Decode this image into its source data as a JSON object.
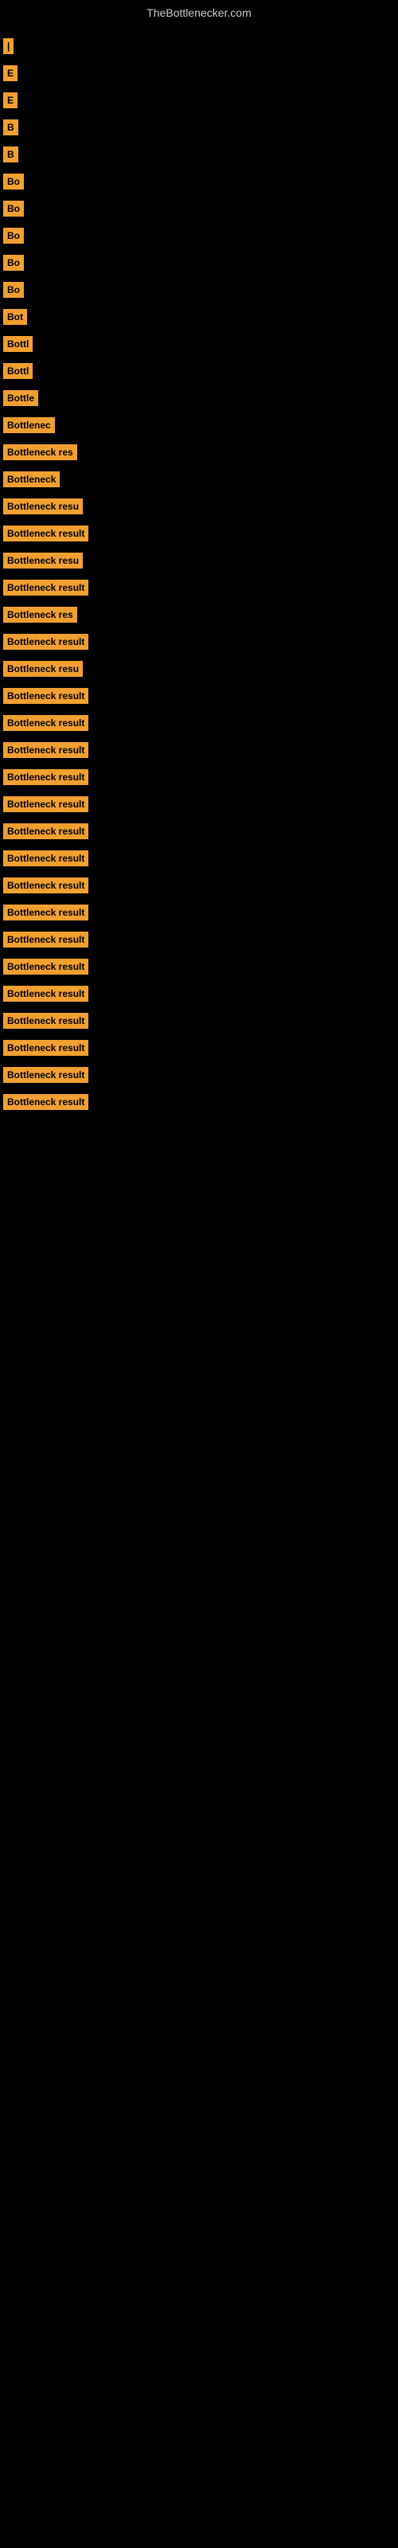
{
  "site": {
    "title": "TheBottlenecker.com"
  },
  "items": [
    {
      "id": 1,
      "label": "|"
    },
    {
      "id": 2,
      "label": "E"
    },
    {
      "id": 3,
      "label": "E"
    },
    {
      "id": 4,
      "label": "B"
    },
    {
      "id": 5,
      "label": "B"
    },
    {
      "id": 6,
      "label": "Bo"
    },
    {
      "id": 7,
      "label": "Bo"
    },
    {
      "id": 8,
      "label": "Bo"
    },
    {
      "id": 9,
      "label": "Bo"
    },
    {
      "id": 10,
      "label": "Bo"
    },
    {
      "id": 11,
      "label": "Bot"
    },
    {
      "id": 12,
      "label": "Bottl"
    },
    {
      "id": 13,
      "label": "Bottl"
    },
    {
      "id": 14,
      "label": "Bottle"
    },
    {
      "id": 15,
      "label": "Bottlenec"
    },
    {
      "id": 16,
      "label": "Bottleneck res"
    },
    {
      "id": 17,
      "label": "Bottleneck"
    },
    {
      "id": 18,
      "label": "Bottleneck resu"
    },
    {
      "id": 19,
      "label": "Bottleneck result"
    },
    {
      "id": 20,
      "label": "Bottleneck resu"
    },
    {
      "id": 21,
      "label": "Bottleneck result"
    },
    {
      "id": 22,
      "label": "Bottleneck res"
    },
    {
      "id": 23,
      "label": "Bottleneck result"
    },
    {
      "id": 24,
      "label": "Bottleneck resu"
    },
    {
      "id": 25,
      "label": "Bottleneck result"
    },
    {
      "id": 26,
      "label": "Bottleneck result"
    },
    {
      "id": 27,
      "label": "Bottleneck result"
    },
    {
      "id": 28,
      "label": "Bottleneck result"
    },
    {
      "id": 29,
      "label": "Bottleneck result"
    },
    {
      "id": 30,
      "label": "Bottleneck result"
    },
    {
      "id": 31,
      "label": "Bottleneck result"
    },
    {
      "id": 32,
      "label": "Bottleneck result"
    },
    {
      "id": 33,
      "label": "Bottleneck result"
    },
    {
      "id": 34,
      "label": "Bottleneck result"
    },
    {
      "id": 35,
      "label": "Bottleneck result"
    },
    {
      "id": 36,
      "label": "Bottleneck result"
    },
    {
      "id": 37,
      "label": "Bottleneck result"
    },
    {
      "id": 38,
      "label": "Bottleneck result"
    },
    {
      "id": 39,
      "label": "Bottleneck result"
    },
    {
      "id": 40,
      "label": "Bottleneck result"
    }
  ]
}
